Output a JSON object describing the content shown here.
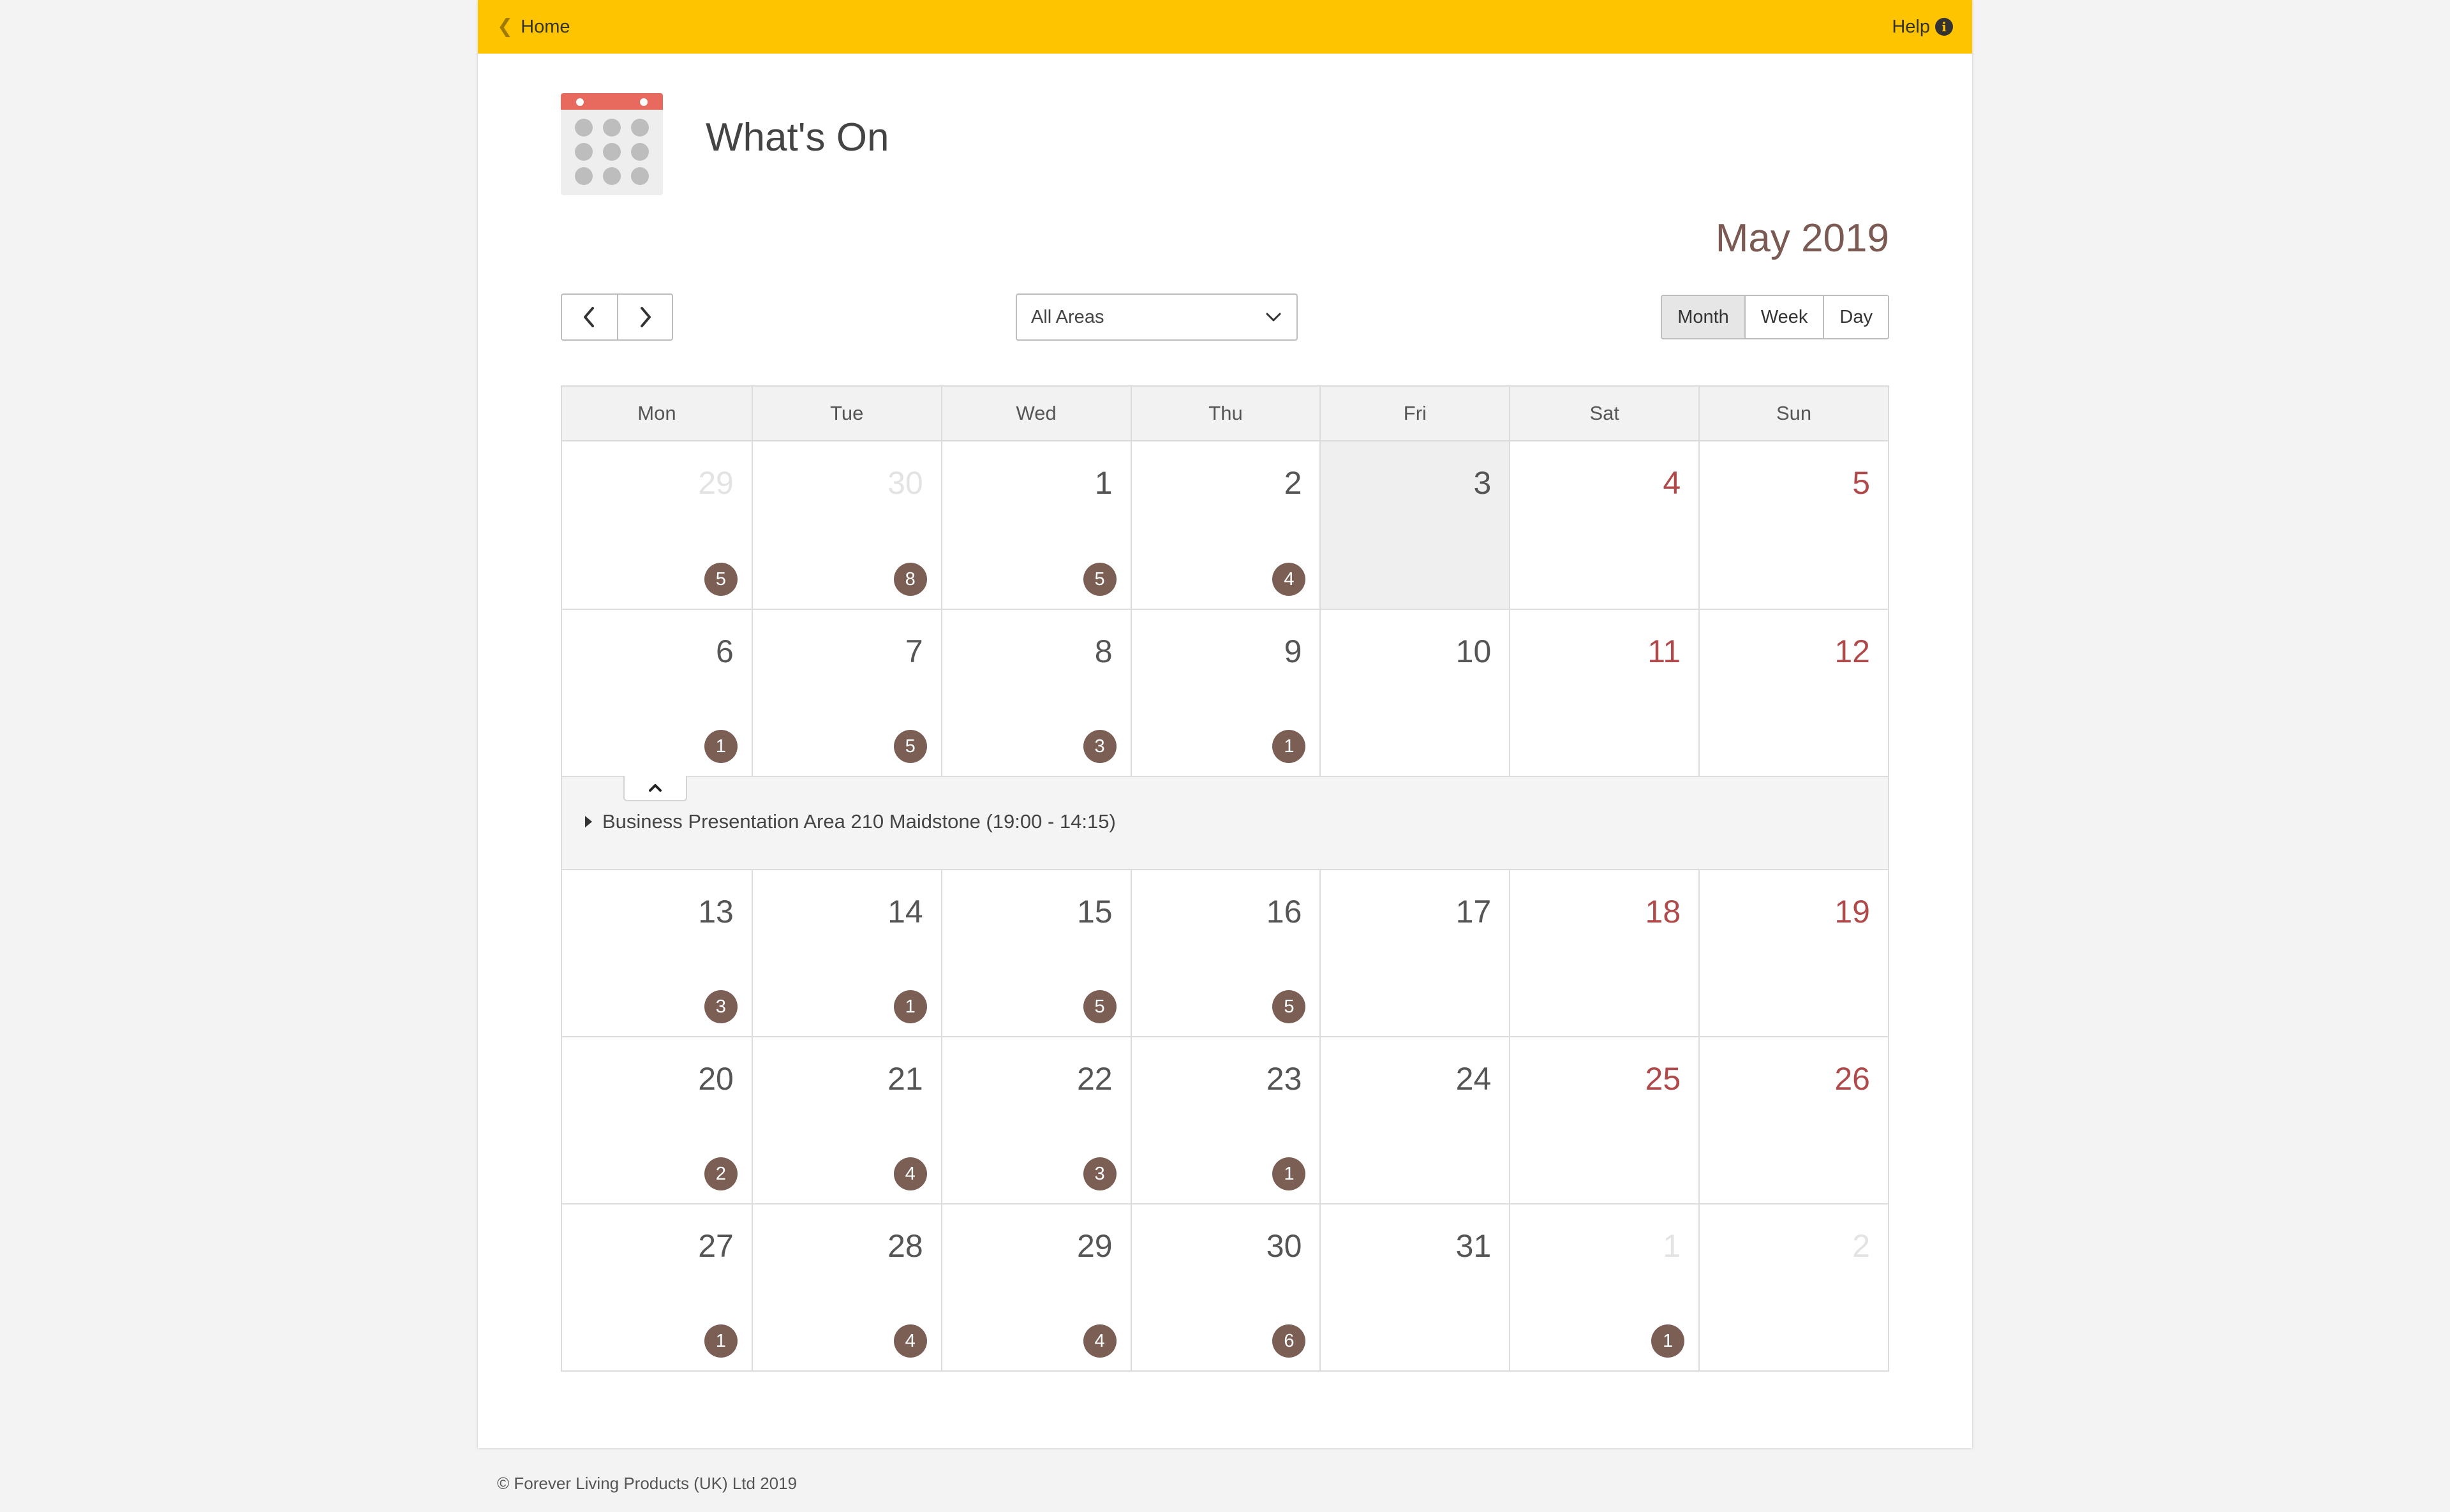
{
  "topbar": {
    "home_label": "Home",
    "help_label": "Help",
    "accent_color": "#ffc400"
  },
  "header": {
    "logo_icon": "calendar-icon",
    "title": "What's On"
  },
  "toolbar": {
    "current_month": "May 2019",
    "prev_icon": "chevron-left-icon",
    "next_icon": "chevron-right-icon",
    "area_filter": {
      "selected": "All Areas"
    },
    "views": [
      {
        "label": "Month",
        "active": true
      },
      {
        "label": "Week",
        "active": false
      },
      {
        "label": "Day",
        "active": false
      }
    ]
  },
  "calendar": {
    "weekdays": [
      "Mon",
      "Tue",
      "Wed",
      "Thu",
      "Fri",
      "Sat",
      "Sun"
    ],
    "weeks": [
      [
        {
          "day": "29",
          "count": "5",
          "other": true
        },
        {
          "day": "30",
          "count": "8",
          "other": true
        },
        {
          "day": "1",
          "count": "5"
        },
        {
          "day": "2",
          "count": "4"
        },
        {
          "day": "3",
          "count": "",
          "today": true
        },
        {
          "day": "4",
          "count": "",
          "weekend": true
        },
        {
          "day": "5",
          "count": "",
          "weekend": true
        }
      ],
      [
        {
          "day": "6",
          "count": "1"
        },
        {
          "day": "7",
          "count": "5"
        },
        {
          "day": "8",
          "count": "3"
        },
        {
          "day": "9",
          "count": "1"
        },
        {
          "day": "10",
          "count": ""
        },
        {
          "day": "11",
          "count": "",
          "weekend": true
        },
        {
          "day": "12",
          "count": "",
          "weekend": true
        }
      ],
      [
        {
          "day": "13",
          "count": "3"
        },
        {
          "day": "14",
          "count": "1"
        },
        {
          "day": "15",
          "count": "5"
        },
        {
          "day": "16",
          "count": "5"
        },
        {
          "day": "17",
          "count": ""
        },
        {
          "day": "18",
          "count": "",
          "weekend": true
        },
        {
          "day": "19",
          "count": "",
          "weekend": true
        }
      ],
      [
        {
          "day": "20",
          "count": "2"
        },
        {
          "day": "21",
          "count": "4"
        },
        {
          "day": "22",
          "count": "3"
        },
        {
          "day": "23",
          "count": "1"
        },
        {
          "day": "24",
          "count": ""
        },
        {
          "day": "25",
          "count": "",
          "weekend": true
        },
        {
          "day": "26",
          "count": "",
          "weekend": true
        }
      ],
      [
        {
          "day": "27",
          "count": "1"
        },
        {
          "day": "28",
          "count": "4"
        },
        {
          "day": "29",
          "count": "4"
        },
        {
          "day": "30",
          "count": "6"
        },
        {
          "day": "31",
          "count": ""
        },
        {
          "day": "1",
          "count": "1",
          "other": true
        },
        {
          "day": "2",
          "count": "",
          "other": true
        }
      ]
    ],
    "expanded_after_week": 1,
    "expanded_events": [
      {
        "label": "Business Presentation Area 210 Maidstone (19:00 - 14:15)"
      }
    ],
    "colors": {
      "badge": "#7b5f55",
      "weekend_number": "#b04a4a",
      "today_background": "#efefef"
    }
  },
  "footer": {
    "copyright": "© Forever Living Products (UK) Ltd 2019"
  }
}
